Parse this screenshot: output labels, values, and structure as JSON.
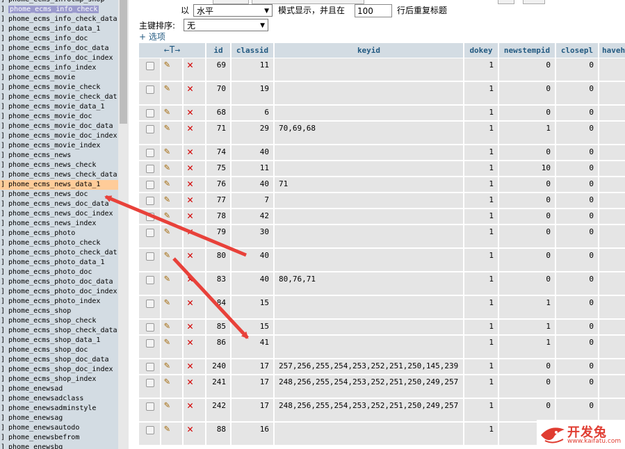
{
  "sidebar": {
    "items": [
      {
        "label": "phome_ecms_infotmp_shop",
        "selected": false,
        "highlight": false
      },
      {
        "label": "phome_ecms_info_check",
        "selected": true,
        "highlight": false
      },
      {
        "label": "phome_ecms_info_check_data",
        "selected": false,
        "highlight": false
      },
      {
        "label": "phome_ecms_info_data_1",
        "selected": false,
        "highlight": false
      },
      {
        "label": "phome_ecms_info_doc",
        "selected": false,
        "highlight": false
      },
      {
        "label": "phome_ecms_info_doc_data",
        "selected": false,
        "highlight": false
      },
      {
        "label": "phome_ecms_info_doc_index",
        "selected": false,
        "highlight": false
      },
      {
        "label": "phome_ecms_info_index",
        "selected": false,
        "highlight": false
      },
      {
        "label": "phome_ecms_movie",
        "selected": false,
        "highlight": false
      },
      {
        "label": "phome_ecms_movie_check",
        "selected": false,
        "highlight": false
      },
      {
        "label": "phome_ecms_movie_check_dat",
        "selected": false,
        "highlight": false
      },
      {
        "label": "phome_ecms_movie_data_1",
        "selected": false,
        "highlight": false
      },
      {
        "label": "phome_ecms_movie_doc",
        "selected": false,
        "highlight": false
      },
      {
        "label": "phome_ecms_movie_doc_data",
        "selected": false,
        "highlight": false
      },
      {
        "label": "phome_ecms_movie_doc_index",
        "selected": false,
        "highlight": false
      },
      {
        "label": "phome_ecms_movie_index",
        "selected": false,
        "highlight": false
      },
      {
        "label": "phome_ecms_news",
        "selected": false,
        "highlight": false
      },
      {
        "label": "phome_ecms_news_check",
        "selected": false,
        "highlight": false
      },
      {
        "label": "phome_ecms_news_check_data",
        "selected": false,
        "highlight": false
      },
      {
        "label": "phome_ecms_news_data_1",
        "selected": false,
        "highlight": true
      },
      {
        "label": "phome_ecms_news_doc",
        "selected": false,
        "highlight": false
      },
      {
        "label": "phome_ecms_news_doc_data",
        "selected": false,
        "highlight": false
      },
      {
        "label": "phome_ecms_news_doc_index",
        "selected": false,
        "highlight": false
      },
      {
        "label": "phome_ecms_news_index",
        "selected": false,
        "highlight": false
      },
      {
        "label": "phome_ecms_photo",
        "selected": false,
        "highlight": false
      },
      {
        "label": "phome_ecms_photo_check",
        "selected": false,
        "highlight": false
      },
      {
        "label": "phome_ecms_photo_check_dat",
        "selected": false,
        "highlight": false
      },
      {
        "label": "phome_ecms_photo_data_1",
        "selected": false,
        "highlight": false
      },
      {
        "label": "phome_ecms_photo_doc",
        "selected": false,
        "highlight": false
      },
      {
        "label": "phome_ecms_photo_doc_data",
        "selected": false,
        "highlight": false
      },
      {
        "label": "phome_ecms_photo_doc_index",
        "selected": false,
        "highlight": false
      },
      {
        "label": "phome_ecms_photo_index",
        "selected": false,
        "highlight": false
      },
      {
        "label": "phome_ecms_shop",
        "selected": false,
        "highlight": false
      },
      {
        "label": "phome_ecms_shop_check",
        "selected": false,
        "highlight": false
      },
      {
        "label": "phome_ecms_shop_check_data",
        "selected": false,
        "highlight": false
      },
      {
        "label": "phome_ecms_shop_data_1",
        "selected": false,
        "highlight": false
      },
      {
        "label": "phome_ecms_shop_doc",
        "selected": false,
        "highlight": false
      },
      {
        "label": "phome_ecms_shop_doc_data",
        "selected": false,
        "highlight": false
      },
      {
        "label": "phome_ecms_shop_doc_index",
        "selected": false,
        "highlight": false
      },
      {
        "label": "phome_ecms_shop_index",
        "selected": false,
        "highlight": false
      },
      {
        "label": "phome_enewsad",
        "selected": false,
        "highlight": false
      },
      {
        "label": "phome_enewsadclass",
        "selected": false,
        "highlight": false
      },
      {
        "label": "phome_enewsadminstyle",
        "selected": false,
        "highlight": false
      },
      {
        "label": "phome_enewsag",
        "selected": false,
        "highlight": false
      },
      {
        "label": "phome_enewsautodo",
        "selected": false,
        "highlight": false
      },
      {
        "label": "phome_enewsbefrom",
        "selected": false,
        "highlight": false
      },
      {
        "label": "phome_enewsbq",
        "selected": false,
        "highlight": false
      }
    ]
  },
  "controls": {
    "mode_prefix": "以",
    "mode_value": "水平",
    "mode_suffix": "模式显示，并且在",
    "repeat_value": "100",
    "repeat_suffix": "行后重复标题",
    "sort_label": "主键排序:",
    "sort_value": "无",
    "options_link": "+ 选项"
  },
  "table": {
    "nav_arrows": "←T→",
    "headers": [
      "id",
      "classid",
      "keyid",
      "dokey",
      "newstempid",
      "closepl",
      "haveh"
    ],
    "rows": [
      {
        "id": "69",
        "classid": "11",
        "keyid": "",
        "dokey": "1",
        "newstempid": "0",
        "closepl": "0"
      },
      {
        "id": "70",
        "classid": "19",
        "keyid": "",
        "dokey": "1",
        "newstempid": "0",
        "closepl": "0"
      },
      {
        "id": "68",
        "classid": "6",
        "keyid": "",
        "dokey": "1",
        "newstempid": "0",
        "closepl": "0"
      },
      {
        "id": "71",
        "classid": "29",
        "keyid": "70,69,68",
        "dokey": "1",
        "newstempid": "1",
        "closepl": "0"
      },
      {
        "id": "74",
        "classid": "40",
        "keyid": "",
        "dokey": "1",
        "newstempid": "0",
        "closepl": "0"
      },
      {
        "id": "75",
        "classid": "11",
        "keyid": "",
        "dokey": "1",
        "newstempid": "10",
        "closepl": "0"
      },
      {
        "id": "76",
        "classid": "40",
        "keyid": "71",
        "dokey": "1",
        "newstempid": "0",
        "closepl": "0"
      },
      {
        "id": "77",
        "classid": "7",
        "keyid": "",
        "dokey": "1",
        "newstempid": "0",
        "closepl": "0"
      },
      {
        "id": "78",
        "classid": "42",
        "keyid": "",
        "dokey": "1",
        "newstempid": "0",
        "closepl": "0"
      },
      {
        "id": "79",
        "classid": "30",
        "keyid": "",
        "dokey": "1",
        "newstempid": "0",
        "closepl": "0"
      },
      {
        "id": "80",
        "classid": "40",
        "keyid": "",
        "dokey": "1",
        "newstempid": "0",
        "closepl": "0"
      },
      {
        "id": "83",
        "classid": "40",
        "keyid": "80,76,71",
        "dokey": "1",
        "newstempid": "0",
        "closepl": "0"
      },
      {
        "id": "84",
        "classid": "15",
        "keyid": "",
        "dokey": "1",
        "newstempid": "1",
        "closepl": "0"
      },
      {
        "id": "85",
        "classid": "15",
        "keyid": "",
        "dokey": "1",
        "newstempid": "1",
        "closepl": "0"
      },
      {
        "id": "86",
        "classid": "41",
        "keyid": "",
        "dokey": "1",
        "newstempid": "1",
        "closepl": "0"
      },
      {
        "id": "240",
        "classid": "17",
        "keyid": "257,256,255,254,253,252,251,250,145,239",
        "dokey": "1",
        "newstempid": "0",
        "closepl": "0"
      },
      {
        "id": "241",
        "classid": "17",
        "keyid": "248,256,255,254,253,252,251,250,249,257",
        "dokey": "1",
        "newstempid": "0",
        "closepl": "0"
      },
      {
        "id": "242",
        "classid": "17",
        "keyid": "248,256,255,254,253,252,251,250,249,257",
        "dokey": "1",
        "newstempid": "0",
        "closepl": "0"
      },
      {
        "id": "88",
        "classid": "16",
        "keyid": "",
        "dokey": "1",
        "newstempid": "",
        "closepl": ""
      }
    ]
  },
  "watermark": {
    "brand": "开发兔",
    "url": "www.kaifatu.com"
  },
  "colors": {
    "header_bg": "#d3dce3",
    "row_bg": "#e5e5e5",
    "annotation_arrow": "#e8413a",
    "delete_icon": "#d40000"
  }
}
